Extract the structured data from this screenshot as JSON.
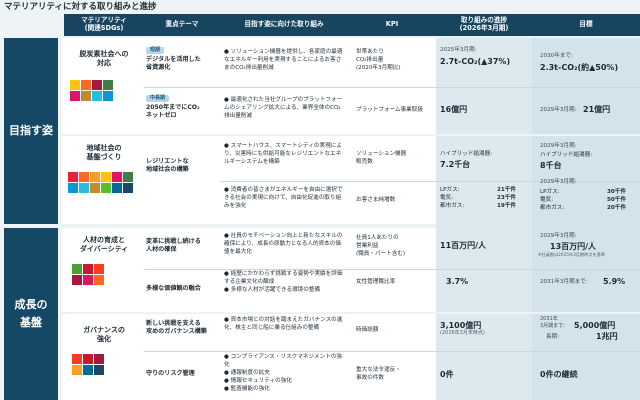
{
  "title": "マテリアリティに対する取り組みと進捗",
  "headers": {
    "materiality": "マテリアリティ\n(関連SDGs)",
    "theme": "重点テーマ",
    "approach": "目指す姿に向けた取り組み",
    "kpi": "KPI",
    "progress": "取り組みの進捗\n(2026年3月期)",
    "target": "目標"
  },
  "groups": {
    "aim": "目指す姿",
    "growth": "成長の\n基盤"
  },
  "rows": {
    "decarb": {
      "materiality": "脱炭素社会への\n対応",
      "theme1_tag": "短期",
      "theme1": "デジタルを活用した\n省資源化",
      "approach1": "● ソリューション機器を提供し、各家庭の最適なエネルギー利用を実現することによるお客さまのCO₂排出量削減",
      "kpi1": "世帯あたり\nCO₂排出量\n(2020年3月期比)",
      "progress1_label": "2025年3月期:",
      "progress1": "2.7t-CO₂(▲37%)",
      "target1_label": "2030年まで:",
      "target1": "2.3t-CO₂(約▲50%)",
      "theme2_tag": "中長期",
      "theme2": "2050年までにCO₂\nネットゼロ",
      "approach2": "● 最適化された当社グループのプラットフォームのシェアリング拡大による、業界全体のCO₂排出量削減",
      "kpi2": "プラットフォーム事業取扱",
      "progress2": "16億円",
      "target2_label": "2029年3月期:",
      "target2": "21億円"
    },
    "community": {
      "materiality": "地域社会の\n基盤づくり",
      "theme": "レジリエントな\n地域社会の構築",
      "approach1": "● スマートハウス、スマートシティの実現により、災害時にも供給可能なレジリエントなエネルギーシステムを構築",
      "kpi1": "ソリューション機器\n販売数",
      "progress1_label": "ハイブリッド給湯器:",
      "progress1": "7.2千台",
      "target1_label": "2029年3月期:",
      "target1_sub": "ハイブリッド給湯器:",
      "target1": "8千台",
      "approach2": "● 消費者の皆さまがエネルギーを自由に選択できる社会の実現に向けて、自由化促進の取り組みを強化",
      "kpi2": "お客さま純増数",
      "progress2": [
        {
          "label": "LPガス:",
          "value": "21千件"
        },
        {
          "label": "電気:",
          "value": "23千件"
        },
        {
          "label": "都市ガス:",
          "value": "19千件"
        }
      ],
      "target2_label": "2029年3月期:",
      "target2": [
        {
          "label": "LPガス:",
          "value": "30千件"
        },
        {
          "label": "電気:",
          "value": "50千件"
        },
        {
          "label": "都市ガス:",
          "value": "20千件"
        }
      ]
    },
    "people": {
      "materiality": "人材の育成と\nダイバーシティ",
      "theme1": "変革に挑戦し続ける\n人材の確保",
      "approach1": "● 社員のモチベーション向上と新たなスキルの確保により、成長の原動力となる人的資本の価値を最大化",
      "kpi1": "社員1人あたりの\n営業利益\n(職員・パート含む)",
      "progress1": "11百万円/人",
      "target1_label": "2029年3月期:",
      "target1": "13百万円/人",
      "target1_note": "※社員数は2025年3月期時点を基準",
      "theme2": "多様な価値観の融合",
      "approach2": "● 経歴にかかわらず挑戦する姿勢や実績を評価する企業文化の醸成\n● 多様な人材が活躍できる環境の整備",
      "kpi2": "女性管理職比率",
      "progress2": "3.7%",
      "target2_label": "2031年3月期まで:",
      "target2": "5.9%"
    },
    "governance": {
      "materiality": "ガバナンスの\n強化",
      "theme1": "新しい挑戦を支える\n攻めのガバナンス構築",
      "approach1": "● 資本市場との対話を踏まえたガバナンスの進化、株主と同じ船に乗る仕組みの整備",
      "kpi1": "時価総額",
      "progress1": "3,100億円",
      "progress1_note": "(2026年3月末時点)",
      "target1_label": "2031年\n3月期まで:",
      "target1": "5,000億円",
      "target1_label2": "長期:",
      "target1_2": "1兆円",
      "theme2": "守りのリスク管理",
      "approach2": "● コンプライアンス・リスクマネジメントの強化\n● 通報制度の拡充\n● 情報セキュリティの強化\n● 監査機能の強化",
      "kpi2": "重大な法令違反・\n事故の件数",
      "progress2": "0件",
      "target2": "0件の継続"
    }
  },
  "colors": {
    "header": "#17445f",
    "group": "#154766",
    "accent": "#1f6d94"
  },
  "sdg_colors": {
    "decarb": [
      "#fcc30b",
      "#fd6925",
      "#a21942",
      "#3f7e44",
      "#dd1367",
      "#bf8b2e",
      "#26bde2",
      "#0a97d9"
    ],
    "community": [
      "#e5243b",
      "#fd6925",
      "#fd9d24",
      "#fcc30b",
      "#dd1367",
      "#3f7e44",
      "#0a97d9",
      "#26bde2",
      "#bf8b2e",
      "#56c02b",
      "#00689d",
      "#19486a"
    ],
    "people": [
      "#4c9f38",
      "#c5192d",
      "#ff3a21",
      "#a21942",
      "#dd1367",
      "#fd6925"
    ],
    "governance": [
      "#ff3a21",
      "#c5192d",
      "#a21942",
      "#fd9d24",
      "#00689d",
      "#19486a"
    ]
  }
}
